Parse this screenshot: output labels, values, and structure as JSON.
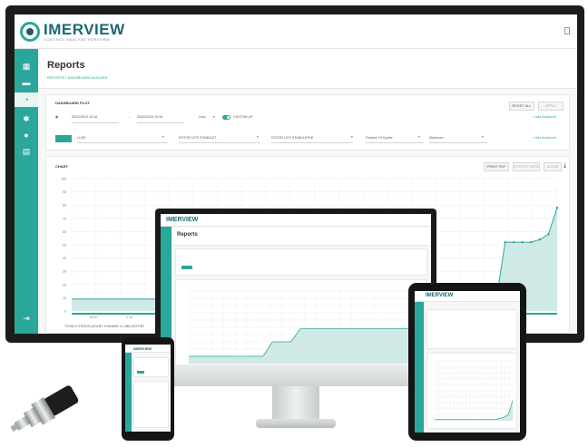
{
  "brand": {
    "name": "IMERVIEW",
    "tagline": "CONTROL ANALYZE PERFORM",
    "color": "#2aa79b",
    "dark_color": "#1e6872"
  },
  "page": {
    "title": "Reports",
    "breadcrumb": "REPORTS / DASHBOARD BUILDER"
  },
  "filters": {
    "label": "DASHBOARD PLOT",
    "start_date": "03/12/2019 15:18",
    "end_date": "03/22/2019 15:18",
    "interval": "Hour",
    "toggle_label": "CUSTOM UP",
    "reset_button": "RESET ALL",
    "apply_button": "APPLY",
    "advanced_link": "+ Add Advanced",
    "device": "LUXE",
    "sensor_a": "ROTOR 1279 STANDLET",
    "sensor_b": "ROTOR 1279 STANDLETHE",
    "metric": "Fraction Of Cycles",
    "unit": "Maximum",
    "advanced_link_2": "+ Add Advanced"
  },
  "chart": {
    "label": "CHART",
    "print_button": "PRINT PDF",
    "export_button": "EXPORT DATA",
    "zoom_button": "ZOOM",
    "legend": "TOTALS STATUS (DOLBY STANDBY & LINK) ROTOR",
    "download_icon": "download-icon"
  },
  "chart_data": {
    "type": "area",
    "x_tick_labels": [
      "00:07",
      "1:12"
    ],
    "y_tick_labels": [
      "100",
      "90",
      "80",
      "70",
      "60",
      "50",
      "40",
      "30",
      "20",
      "10",
      "0"
    ],
    "ylim": [
      0,
      100
    ],
    "series": [
      {
        "values": [
          9,
          9,
          9,
          9,
          9,
          9,
          9,
          9,
          9,
          9,
          9,
          9,
          9,
          9,
          9,
          9,
          9,
          9,
          9,
          9,
          9,
          9,
          9,
          9,
          9,
          9,
          9,
          9,
          9,
          9,
          9,
          9,
          9,
          9,
          9,
          9,
          9,
          9,
          9,
          9,
          9,
          9,
          9,
          9,
          9,
          9,
          9,
          9,
          9,
          9,
          52,
          52,
          52,
          52,
          54,
          58,
          78
        ]
      }
    ],
    "grid": true
  },
  "desktop": {
    "title": "Reports",
    "brand": "IMERVIEW"
  },
  "tablet": {
    "brand": "IMERVIEW"
  },
  "phone": {
    "brand": "IMERVIEW"
  }
}
